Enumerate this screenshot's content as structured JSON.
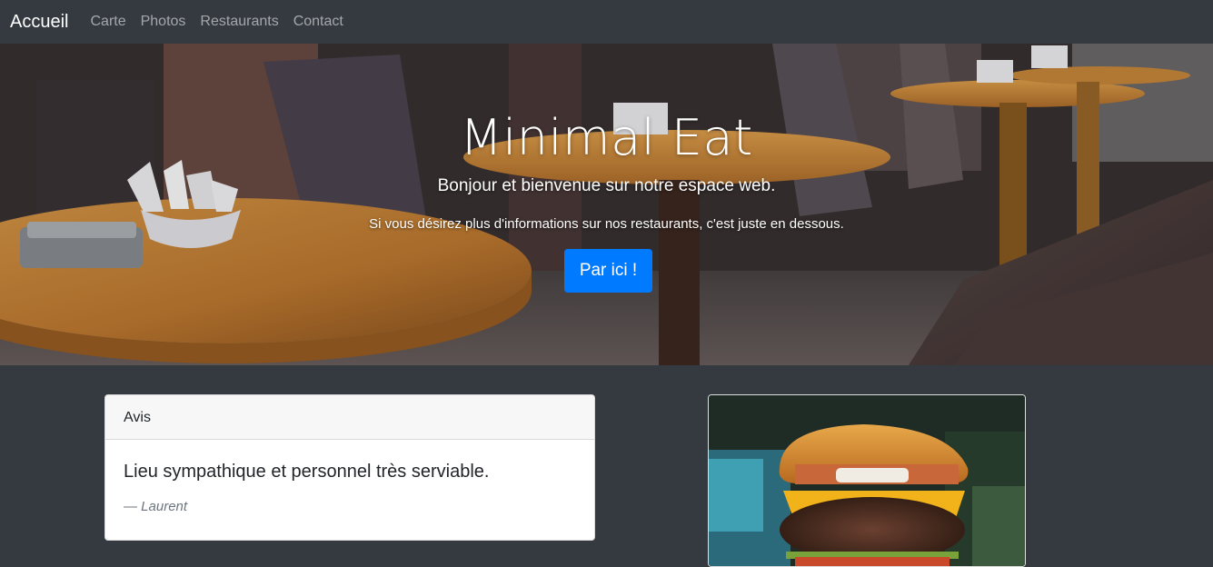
{
  "navbar": {
    "brand": "Accueil",
    "links": [
      "Carte",
      "Photos",
      "Restaurants",
      "Contact"
    ]
  },
  "hero": {
    "title": "Minimal Eat",
    "subtitle": "Bonjour et bienvenue sur notre espace web.",
    "text": "Si vous désirez plus d'informations sur nos restaurants, c'est juste en dessous.",
    "button_label": "Par ici !"
  },
  "review": {
    "header": "Avis",
    "quote": "Lieu sympathique et personnel très serviable.",
    "author": "— Laurent"
  },
  "colors": {
    "navbar_bg": "#343a40",
    "page_bg": "#343a40",
    "primary_button": "#007bff"
  }
}
